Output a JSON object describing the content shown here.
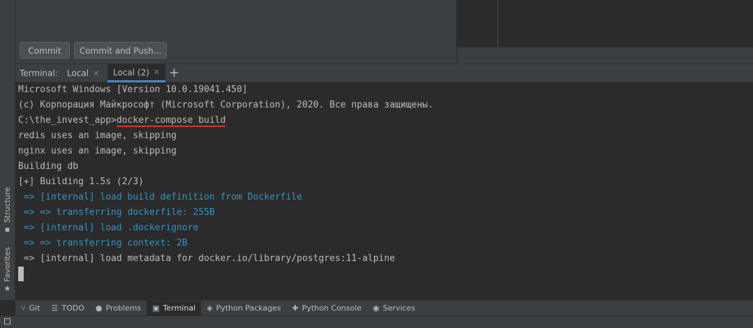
{
  "left_strip": {
    "structure_label": "Structure",
    "favorites_label": "Favorites",
    "structure_icon": "structure-icon",
    "favorites_icon": "star-icon"
  },
  "commit": {
    "commit_label": "Commit",
    "commit_push_label": "Commit and Push..."
  },
  "terminal_tabs": {
    "title": "Terminal:",
    "tabs": [
      {
        "label": "Local",
        "active": false
      },
      {
        "label": "Local (2)",
        "active": true
      }
    ],
    "add_label": "+"
  },
  "terminal": {
    "lines": [
      {
        "text": "Microsoft Windows [Version 10.0.19041.450]",
        "color": "default"
      },
      {
        "text": "(c) Корпорация Майкрософт (Microsoft Corporation), 2020. Все права защищены.",
        "color": "default"
      },
      {
        "prompt": "C:\\the_invest_app>",
        "command": "docker-compose build",
        "underlined": true
      },
      {
        "text": "redis uses an image, skipping",
        "color": "default"
      },
      {
        "text": "nginx uses an image, skipping",
        "color": "default"
      },
      {
        "text": "Building db",
        "color": "default"
      },
      {
        "text": "[+] Building 1.5s (2/3)",
        "color": "default"
      },
      {
        "text": " => [internal] load build definition from Dockerfile",
        "color": "blue"
      },
      {
        "text": " => => transferring dockerfile: 255B",
        "color": "blue"
      },
      {
        "text": " => [internal] load .dockerignore",
        "color": "blue"
      },
      {
        "text": " => => transferring context: 2B",
        "color": "blue"
      },
      {
        "text": " => [internal] load metadata for docker.io/library/postgres:11-alpine",
        "color": "default"
      }
    ],
    "colors": {
      "default": "#bbbbbb",
      "blue": "#3592c4",
      "underline": "#e03030"
    }
  },
  "bottom_bar": {
    "items": [
      {
        "label": "Git",
        "icon": "git-branch-icon",
        "glyph": "⑂",
        "active": false
      },
      {
        "label": "TODO",
        "icon": "list-icon",
        "glyph": "☰",
        "active": false
      },
      {
        "label": "Problems",
        "icon": "problems-icon",
        "glyph": "●",
        "active": false
      },
      {
        "label": "Terminal",
        "icon": "terminal-icon",
        "glyph": "▣",
        "active": true
      },
      {
        "label": "Python Packages",
        "icon": "packages-icon",
        "glyph": "◈",
        "active": false
      },
      {
        "label": "Python Console",
        "icon": "python-console-icon",
        "glyph": "✚",
        "active": false
      },
      {
        "label": "Services",
        "icon": "services-icon",
        "glyph": "◉",
        "active": false
      }
    ]
  }
}
